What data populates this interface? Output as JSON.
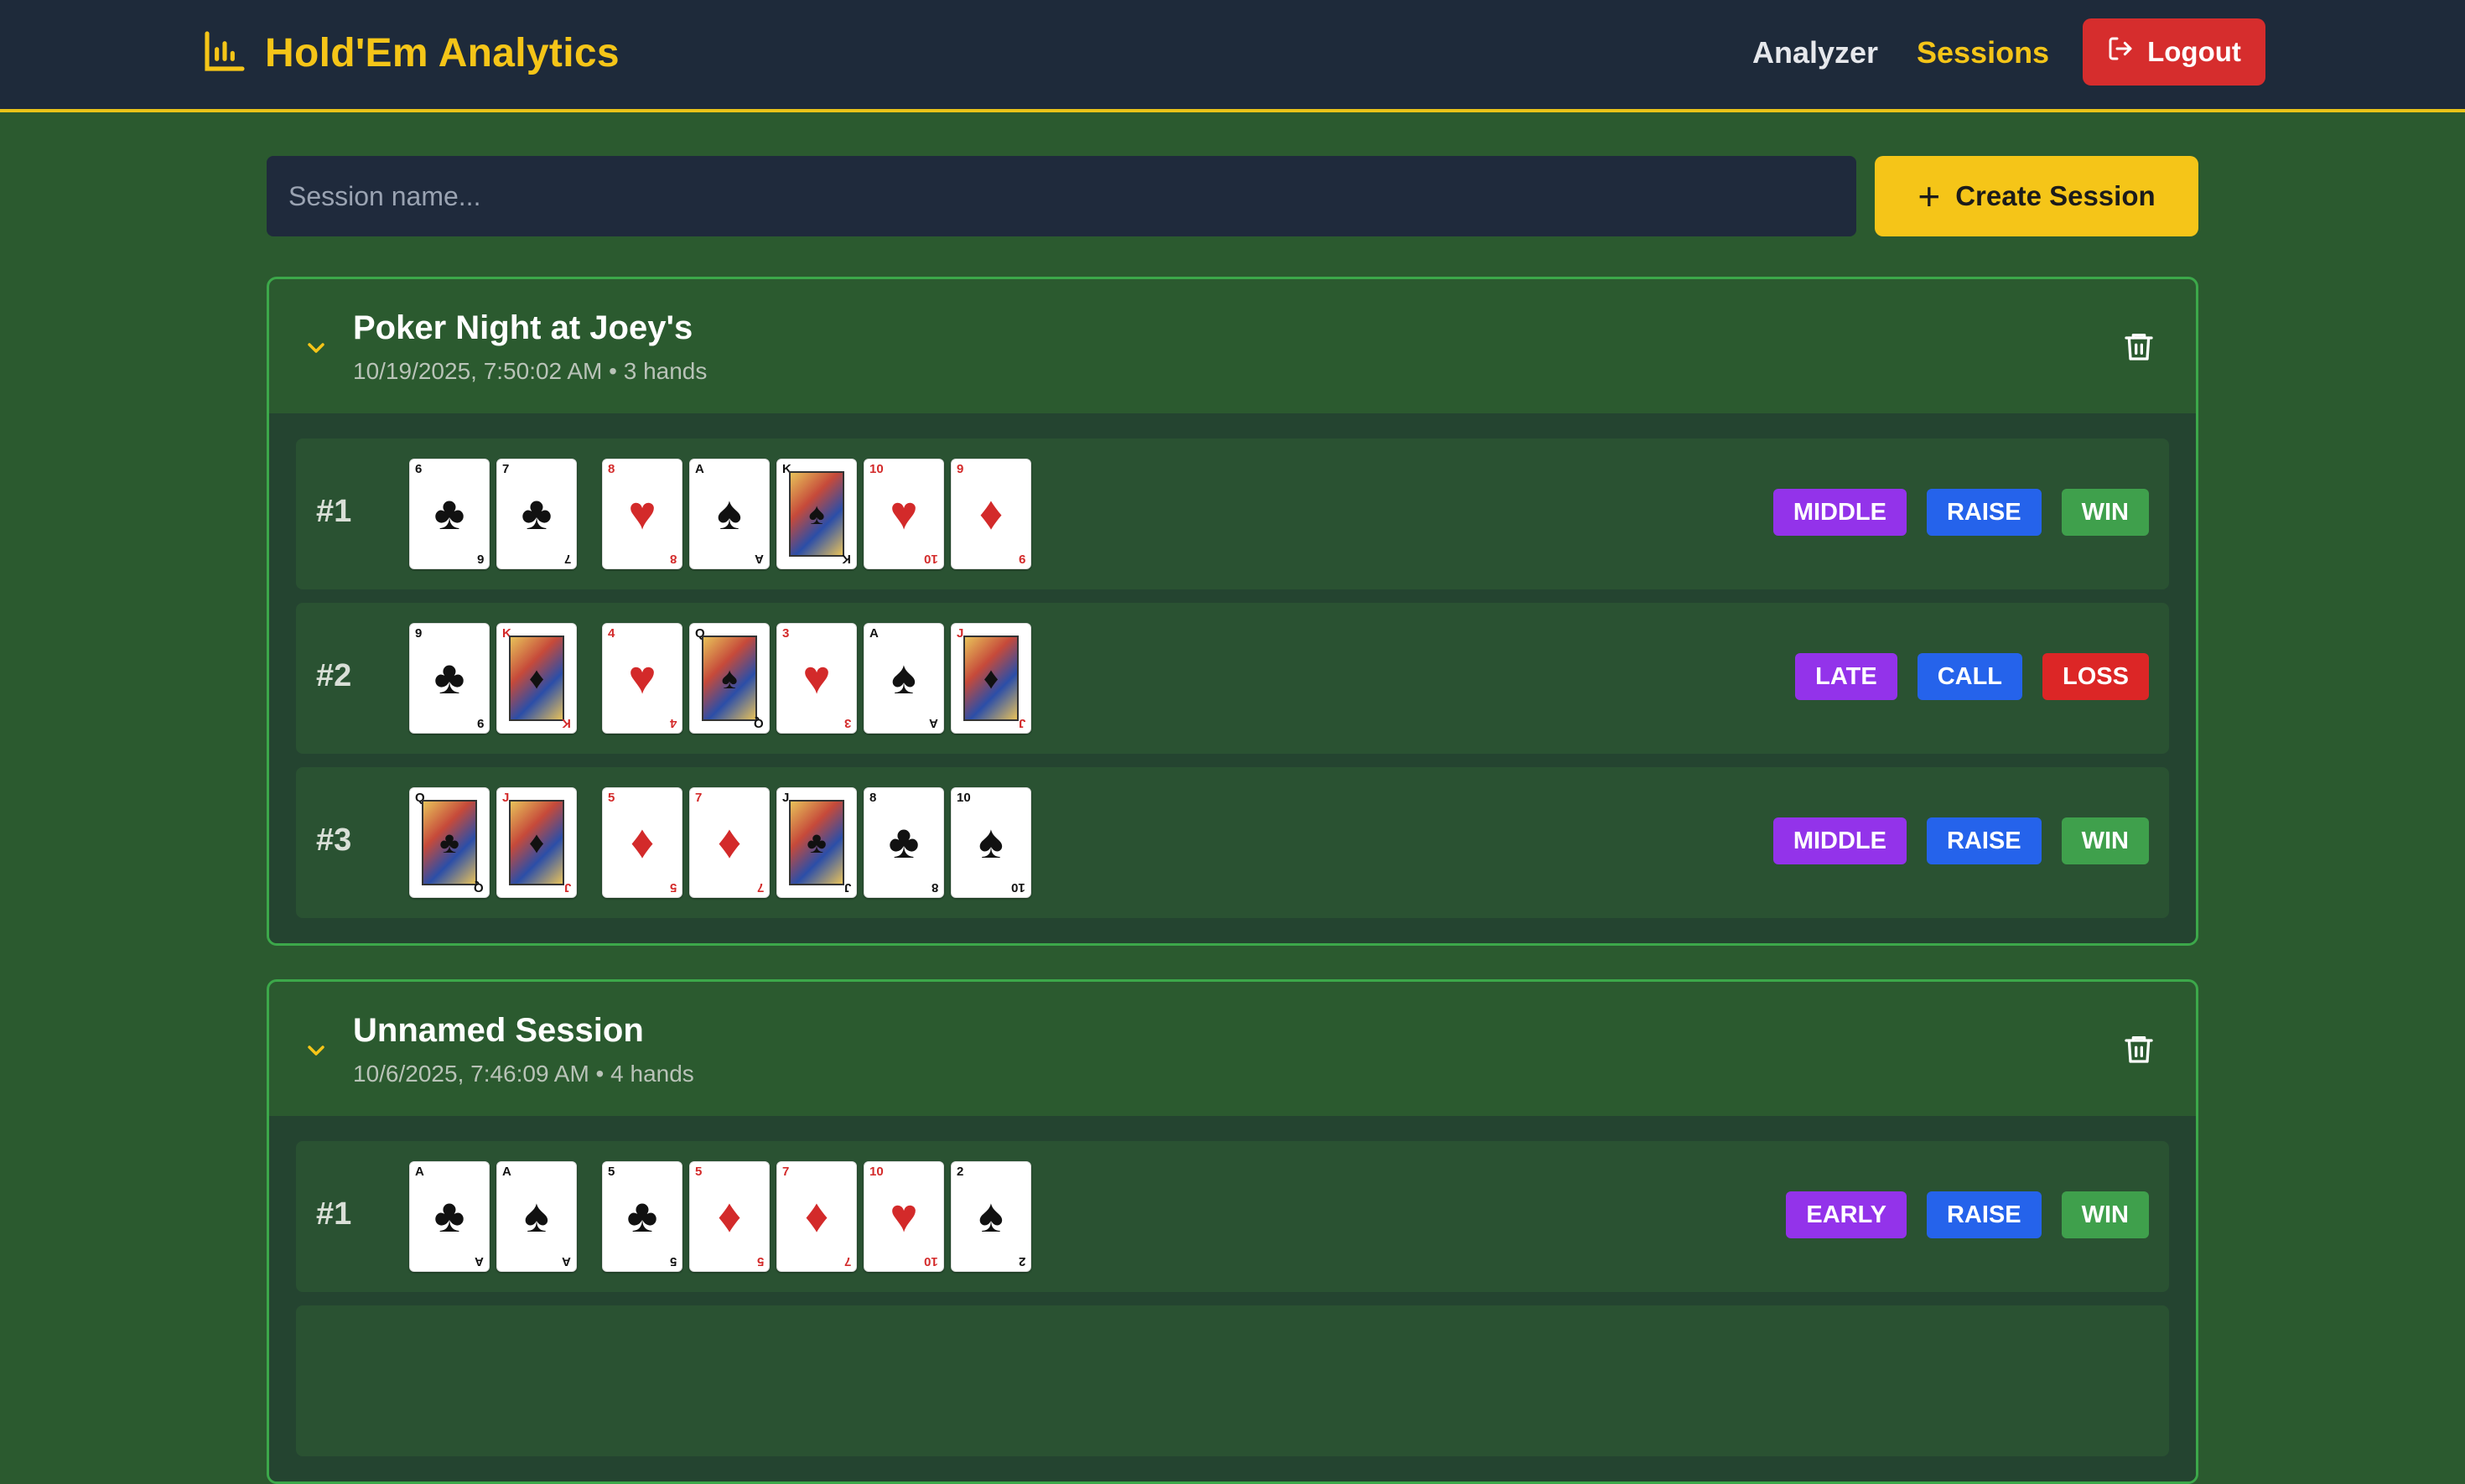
{
  "nav": {
    "brand": "Hold'Em Analytics",
    "brand_icon": "bar-chart-icon",
    "links": [
      "Analyzer",
      "Sessions"
    ],
    "logout": "Logout",
    "accent": "#f5c518"
  },
  "create": {
    "placeholder": "Session name...",
    "button": "Create Session"
  },
  "sessions": [
    {
      "title": "Poker Night at Joey's",
      "meta": "10/19/2025, 7:50:02 AM • 3 hands",
      "hands": [
        {
          "num": "#1",
          "hole": [
            [
              "6",
              "♣",
              "black"
            ],
            [
              "7",
              "♣",
              "black"
            ]
          ],
          "board": [
            [
              "8",
              "♥",
              "red"
            ],
            [
              "A",
              "♠",
              "black"
            ],
            [
              "K",
              "♠",
              "black"
            ],
            [
              "10",
              "♥",
              "red"
            ],
            [
              "9",
              "♦",
              "red"
            ]
          ],
          "position": "MIDDLE",
          "action": "RAISE",
          "result": "WIN"
        },
        {
          "num": "#2",
          "hole": [
            [
              "9",
              "♣",
              "black"
            ],
            [
              "K",
              "♦",
              "red"
            ]
          ],
          "board": [
            [
              "4",
              "♥",
              "red"
            ],
            [
              "Q",
              "♠",
              "black"
            ],
            [
              "3",
              "♥",
              "red"
            ],
            [
              "A",
              "♠",
              "black"
            ],
            [
              "J",
              "♦",
              "red"
            ]
          ],
          "position": "LATE",
          "action": "CALL",
          "result": "LOSS"
        },
        {
          "num": "#3",
          "hole": [
            [
              "Q",
              "♣",
              "black"
            ],
            [
              "J",
              "♦",
              "red"
            ]
          ],
          "board": [
            [
              "5",
              "♦",
              "red"
            ],
            [
              "7",
              "♦",
              "red"
            ],
            [
              "J",
              "♣",
              "black"
            ],
            [
              "8",
              "♣",
              "black"
            ],
            [
              "10",
              "♠",
              "black"
            ]
          ],
          "position": "MIDDLE",
          "action": "RAISE",
          "result": "WIN"
        }
      ]
    },
    {
      "title": "Unnamed Session",
      "meta": "10/6/2025, 7:46:09 AM • 4 hands",
      "hands": [
        {
          "num": "#1",
          "hole": [
            [
              "A",
              "♣",
              "black"
            ],
            [
              "A",
              "♠",
              "black"
            ]
          ],
          "board": [
            [
              "5",
              "♣",
              "black"
            ],
            [
              "5",
              "♦",
              "red"
            ],
            [
              "7",
              "♦",
              "red"
            ],
            [
              "10",
              "♥",
              "red"
            ],
            [
              "2",
              "♠",
              "black"
            ]
          ],
          "position": "EARLY",
          "action": "RAISE",
          "result": "WIN"
        }
      ]
    }
  ]
}
